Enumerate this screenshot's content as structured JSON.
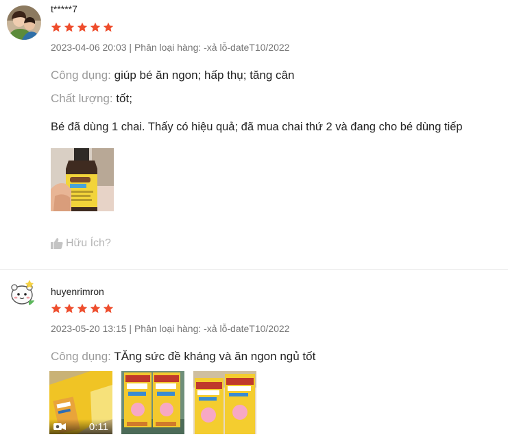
{
  "reviews": [
    {
      "username": "t*****7",
      "rating": 5,
      "meta": "2023-04-06 20:03 | Phân loại hàng: -xả lỗ-dateT10/2022",
      "attributes": [
        {
          "label": "Công dụng:",
          "value": "giúp bé ăn ngon; hấp thụ; tăng cân"
        },
        {
          "label": "Chất lượng:",
          "value": "tốt;"
        }
      ],
      "body": "Bé đã dùng 1 chai. Thấy có hiệu quả; đã mua chai thứ 2 và đang cho bé dùng tiếp",
      "media": [
        {
          "type": "image",
          "icon": "product-photo"
        }
      ],
      "helpful_label": "Hữu Ích?"
    },
    {
      "username": "huyenrimron",
      "rating": 5,
      "meta": "2023-05-20 13:15 | Phân loại hàng: -xả lỗ-dateT10/2022",
      "attributes": [
        {
          "label": "Công dụng:",
          "value": "TĂng sức đề kháng và ăn ngon ngủ tốt"
        }
      ],
      "media": [
        {
          "type": "video",
          "duration": "0:11"
        },
        {
          "type": "image",
          "icon": "product-photo"
        },
        {
          "type": "image",
          "icon": "product-photo"
        }
      ]
    }
  ],
  "colors": {
    "star": "#ee4d2d",
    "label": "#9a9a9a",
    "meta": "#757575",
    "helpful": "#b5b5b5"
  }
}
